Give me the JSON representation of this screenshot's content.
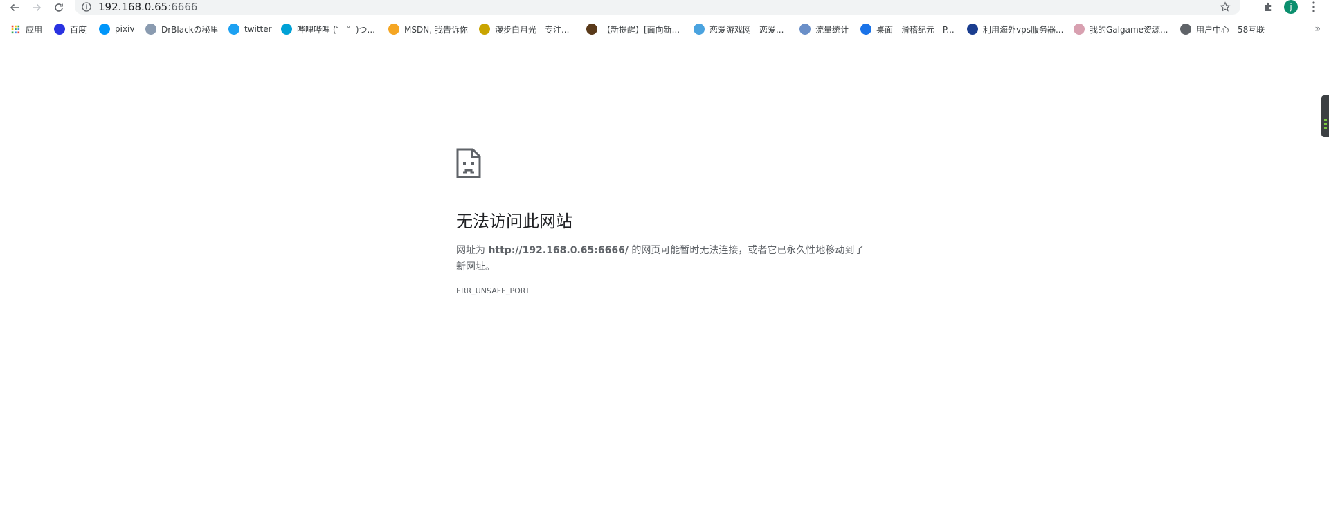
{
  "toolbar": {
    "url_host": "192.168.0.65",
    "url_port": ":6666",
    "avatar_letter": "j"
  },
  "bookmarks": [
    {
      "label": "应用",
      "icon": "apps-grid-icon",
      "color": "#e94235"
    },
    {
      "label": "百度",
      "icon": "baidu-paw-icon",
      "color": "#2932e1"
    },
    {
      "label": "pixiv",
      "icon": "pixiv-icon",
      "color": "#0096fa"
    },
    {
      "label": "DrBlackの秘里",
      "icon": "drblack-icon",
      "color": "#8a9bb0"
    },
    {
      "label": "twitter",
      "icon": "twitter-bird-icon",
      "color": "#1da1f2"
    },
    {
      "label": "哔哩哔哩 (゜-゜)つ...",
      "icon": "bilibili-icon",
      "color": "#00a1d6"
    },
    {
      "label": "MSDN, 我告诉你",
      "icon": "msdn-icon",
      "color": "#f5a623"
    },
    {
      "label": "漫步白月光 - 专注...",
      "icon": "moon-icon",
      "color": "#c9a400"
    },
    {
      "label": "【新提醒】[面向新...",
      "icon": "minecraft-block-icon",
      "color": "#5a3a1a"
    },
    {
      "label": "恋爱游戏网 - 恋爱...",
      "icon": "flower-icon",
      "color": "#4aa3df"
    },
    {
      "label": "流量统计",
      "icon": "globe-icon",
      "color": "#6a8fc8"
    },
    {
      "label": "桌面 - 滑稽纪元 - P...",
      "icon": "k-icon",
      "color": "#1a73e8"
    },
    {
      "label": "利用海外vps服务器...",
      "icon": "scotland-flag-icon",
      "color": "#1a3d8f"
    },
    {
      "label": "我的Galgame资源...",
      "icon": "galgame-icon",
      "color": "#d8a0b0"
    },
    {
      "label": "用户中心 - 58互联",
      "icon": "world-icon",
      "color": "#5f6368"
    }
  ],
  "bookmarks_more": "»",
  "error": {
    "title": "无法访问此网站",
    "desc_prefix": "网址为 ",
    "desc_url": "http://192.168.0.65:6666/",
    "desc_suffix": " 的网页可能暂时无法连接，或者它已永久性地移动到了新网址。",
    "code": "ERR_UNSAFE_PORT"
  }
}
